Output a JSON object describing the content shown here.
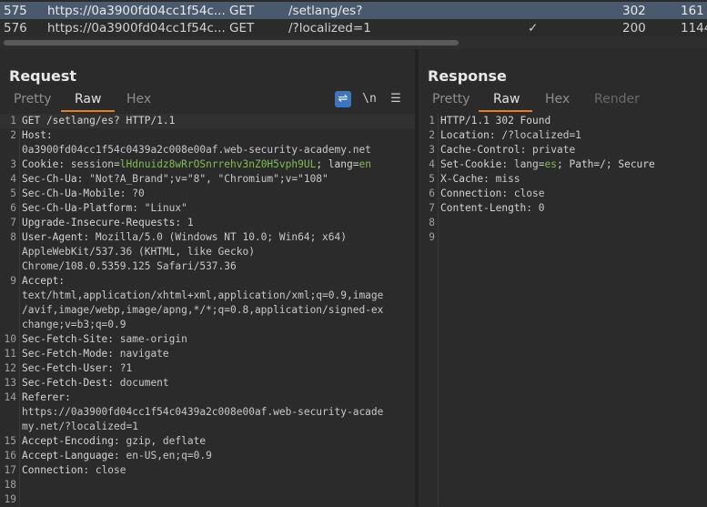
{
  "history": {
    "rows": [
      {
        "num": "575",
        "host": "https://0a3900fd04cc1f54c...",
        "method": "GET",
        "url": "/setlang/es?",
        "check": "",
        "status": "302",
        "length": "161",
        "selected": true
      },
      {
        "num": "576",
        "host": "https://0a3900fd04cc1f54c...",
        "method": "GET",
        "url": "/?localized=1",
        "check": "✓",
        "status": "200",
        "length": "1144",
        "selected": false
      }
    ]
  },
  "request": {
    "title": "Request",
    "tabs": [
      "Pretty",
      "Raw",
      "Hex"
    ],
    "active_tab": "Raw",
    "tools": {
      "wrap": "⇌",
      "newline": "\\n",
      "menu": "☰"
    },
    "lines": [
      {
        "n": "1",
        "k": "GET /setlang/es? HTTP/1.1",
        "v": ""
      },
      {
        "n": "2",
        "k": "Host",
        "v": ":"
      },
      {
        "n": "",
        "k": "",
        "v": "0a3900fd04cc1f54c0439a2c008e00af.web-security-academy.net"
      },
      {
        "n": "3",
        "k": "Cookie",
        "v": ": session=",
        "g": "lHdnuidz8wRrOSnrrehv3nZ0H5vph9UL",
        "k2": "; lang=",
        "g2": "en"
      },
      {
        "n": "4",
        "k": "Sec-Ch-Ua",
        "v": ": \"Not?A_Brand\";v=\"8\", \"Chromium\";v=\"108\""
      },
      {
        "n": "5",
        "k": "Sec-Ch-Ua-Mobile",
        "v": ": ?0"
      },
      {
        "n": "6",
        "k": "Sec-Ch-Ua-Platform",
        "v": ": \"Linux\""
      },
      {
        "n": "7",
        "k": "Upgrade-Insecure-Requests",
        "v": ": 1"
      },
      {
        "n": "8",
        "k": "User-Agent",
        "v": ": Mozilla/5.0 (Windows NT 10.0; Win64; x64)"
      },
      {
        "n": "",
        "k": "",
        "v": "AppleWebKit/537.36 (KHTML, like Gecko)"
      },
      {
        "n": "",
        "k": "",
        "v": "Chrome/108.0.5359.125 Safari/537.36"
      },
      {
        "n": "9",
        "k": "Accept",
        "v": ":"
      },
      {
        "n": "",
        "k": "",
        "v": "text/html,application/xhtml+xml,application/xml;q=0.9,image"
      },
      {
        "n": "",
        "k": "",
        "v": "/avif,image/webp,image/apng,*/*;q=0.8,application/signed-ex"
      },
      {
        "n": "",
        "k": "",
        "v": "change;v=b3;q=0.9"
      },
      {
        "n": "10",
        "k": "Sec-Fetch-Site",
        "v": ": same-origin"
      },
      {
        "n": "11",
        "k": "Sec-Fetch-Mode",
        "v": ": navigate"
      },
      {
        "n": "12",
        "k": "Sec-Fetch-User",
        "v": ": ?1"
      },
      {
        "n": "13",
        "k": "Sec-Fetch-Dest",
        "v": ": document"
      },
      {
        "n": "14",
        "k": "Referer",
        "v": ":"
      },
      {
        "n": "",
        "k": "",
        "v": "https://0a3900fd04cc1f54c0439a2c008e00af.web-security-acade"
      },
      {
        "n": "",
        "k": "",
        "v": "my.net/?localized=1"
      },
      {
        "n": "15",
        "k": "Accept-Encoding",
        "v": ": gzip, deflate"
      },
      {
        "n": "16",
        "k": "Accept-Language",
        "v": ": en-US,en;q=0.9"
      },
      {
        "n": "17",
        "k": "Connection",
        "v": ": close"
      },
      {
        "n": "18",
        "k": "",
        "v": ""
      },
      {
        "n": "19",
        "k": "",
        "v": ""
      }
    ]
  },
  "response": {
    "title": "Response",
    "tabs": [
      "Pretty",
      "Raw",
      "Hex",
      "Render"
    ],
    "active_tab": "Raw",
    "lines": [
      {
        "n": "1",
        "k": "HTTP/1.1 302 Found",
        "v": ""
      },
      {
        "n": "2",
        "k": "Location",
        "v": ": /?localized=1"
      },
      {
        "n": "3",
        "k": "Cache-Control",
        "v": ": private"
      },
      {
        "n": "4",
        "k": "Set-Cookie",
        "v": ": lang=",
        "g": "es",
        "k2": "; Path=/; Secure"
      },
      {
        "n": "5",
        "k": "X-Cache",
        "v": ": miss"
      },
      {
        "n": "6",
        "k": "Connection",
        "v": ": close"
      },
      {
        "n": "7",
        "k": "Content-Length",
        "v": ": 0"
      },
      {
        "n": "8",
        "k": "",
        "v": ""
      },
      {
        "n": "9",
        "k": "",
        "v": ""
      }
    ]
  }
}
